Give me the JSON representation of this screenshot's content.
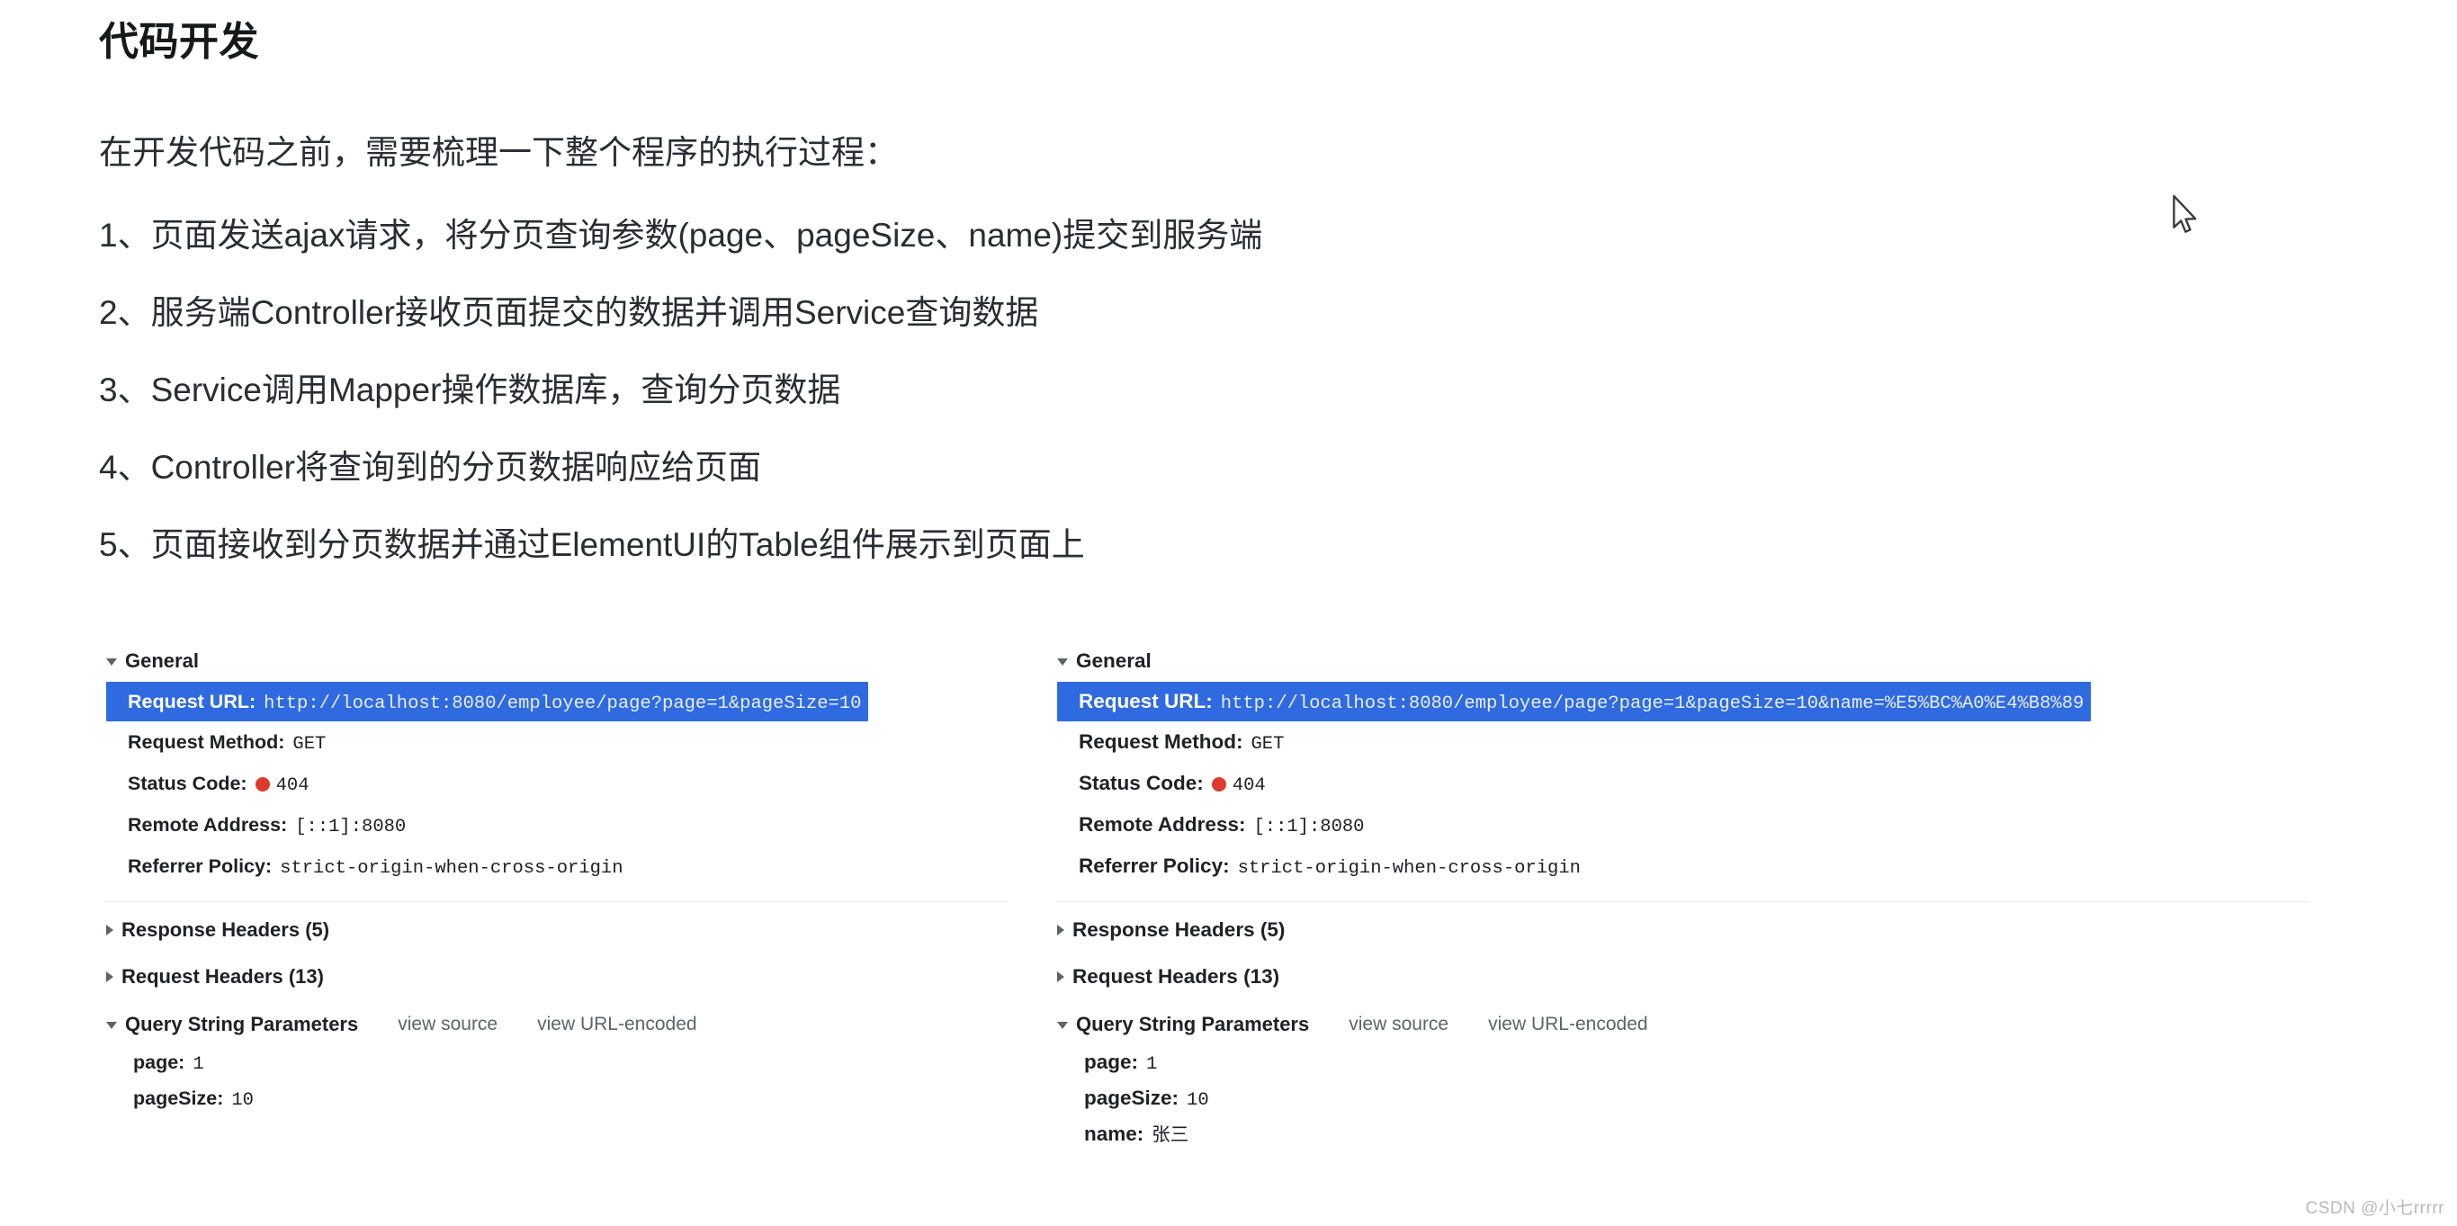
{
  "document": {
    "title": "代码开发",
    "paragraphs": [
      "在开发代码之前，需要梳理一下整个程序的执行过程：",
      "1、页面发送ajax请求，将分页查询参数(page、pageSize、name)提交到服务端",
      "2、服务端Controller接收页面提交的数据并调用Service查询数据",
      "3、Service调用Mapper操作数据库，查询分页数据",
      "4、Controller将查询到的分页数据响应给页面",
      "5、页面接收到分页数据并通过ElementUI的Table组件展示到页面上"
    ]
  },
  "devtools": {
    "left_panel": {
      "general_label": "General",
      "general": {
        "request_url_label": "Request URL:",
        "request_url_value": "http://localhost:8080/employee/page?page=1&pageSize=10",
        "request_method_label": "Request Method:",
        "request_method_value": "GET",
        "status_code_label": "Status Code:",
        "status_code_value": "404",
        "status_dot_color": "#dd3a2b",
        "remote_address_label": "Remote Address:",
        "remote_address_value": "[::1]:8080",
        "referrer_policy_label": "Referrer Policy:",
        "referrer_policy_value": "strict-origin-when-cross-origin"
      },
      "response_headers_label": "Response Headers (5)",
      "request_headers_label": "Request Headers (13)",
      "query_string_label": "Query String Parameters",
      "view_source_label": "view source",
      "view_url_encoded_label": "view URL-encoded",
      "query_params": [
        {
          "key": "page:",
          "value": "1"
        },
        {
          "key": "pageSize:",
          "value": "10"
        }
      ]
    },
    "right_panel": {
      "general_label": "General",
      "general": {
        "request_url_label": "Request URL:",
        "request_url_value": "http://localhost:8080/employee/page?page=1&pageSize=10&name=%E5%BC%A0%E4%B8%89",
        "request_method_label": "Request Method:",
        "request_method_value": "GET",
        "status_code_label": "Status Code:",
        "status_code_value": "404",
        "status_dot_color": "#dd3a2b",
        "remote_address_label": "Remote Address:",
        "remote_address_value": "[::1]:8080",
        "referrer_policy_label": "Referrer Policy:",
        "referrer_policy_value": "strict-origin-when-cross-origin"
      },
      "response_headers_label": "Response Headers (5)",
      "request_headers_label": "Request Headers (13)",
      "query_string_label": "Query String Parameters",
      "view_source_label": "view source",
      "view_url_encoded_label": "view URL-encoded",
      "query_params": [
        {
          "key": "page:",
          "value": "1"
        },
        {
          "key": "pageSize:",
          "value": "10"
        },
        {
          "key": "name:",
          "value": "张三"
        }
      ]
    }
  },
  "watermark": "CSDN @小七rrrrr",
  "theme": {
    "selection_blue": "#2f6ae0",
    "status_error_red": "#dd3a2b",
    "divider_gray": "#e6e6e6"
  }
}
